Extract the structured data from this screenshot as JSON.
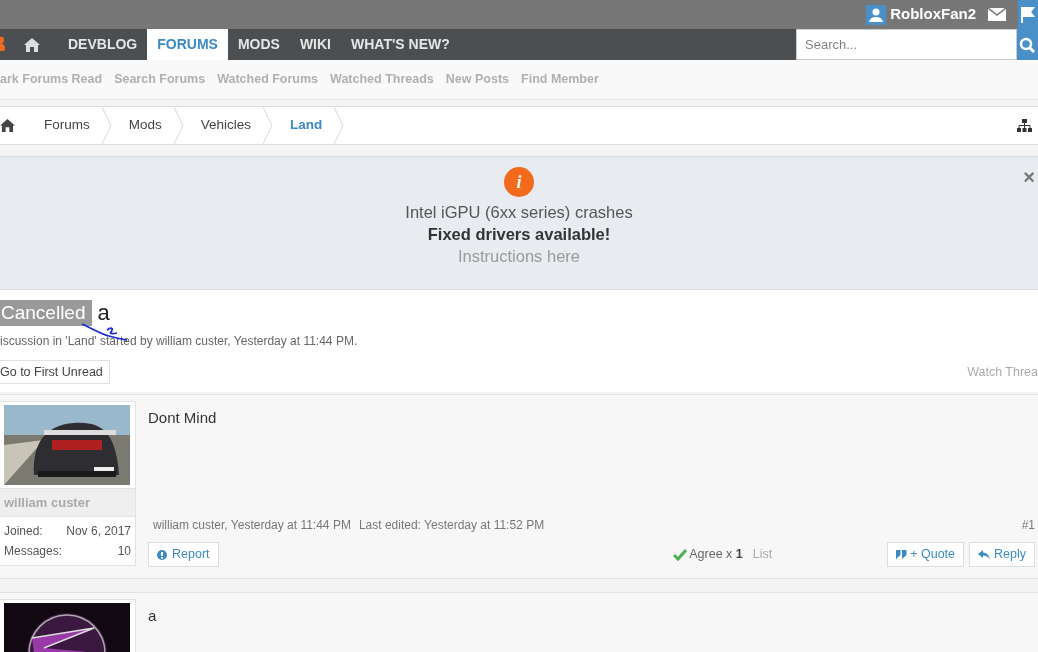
{
  "user_bar": {
    "username": "RobloxFan2"
  },
  "nav": {
    "tabs": [
      {
        "label": "DEVBLOG",
        "selected": false
      },
      {
        "label": "FORUMS",
        "selected": true
      },
      {
        "label": "MODS",
        "selected": false
      },
      {
        "label": "WIKI",
        "selected": false
      },
      {
        "label": "WHAT'S NEW?",
        "selected": false
      }
    ],
    "search": {
      "placeholder": "Search..."
    }
  },
  "sub_nav": [
    "ark Forums Read",
    "Search Forums",
    "Watched Forums",
    "Watched Threads",
    "New Posts",
    "Find Member"
  ],
  "breadcrumb": [
    {
      "label": "Forums",
      "selected": false
    },
    {
      "label": "Mods",
      "selected": false
    },
    {
      "label": "Vehicles",
      "selected": false
    },
    {
      "label": "Land",
      "selected": true
    }
  ],
  "notice": {
    "icon": "i",
    "lines": [
      "Intel iGPU (6xx series) crashes",
      "Fixed drivers available!",
      "Instructions here"
    ],
    "close": "×"
  },
  "thread": {
    "prefix": "Cancelled",
    "title": "a",
    "meta": "iscussion in 'Land' started by william custer, Yesterday at 11:44 PM.",
    "first_unread": "Go to First Unread",
    "watch": "Watch Threa"
  },
  "posts": [
    {
      "username": "william custer",
      "joined_label": "Joined:",
      "joined": "Nov 6, 2017",
      "messages_label": "Messages:",
      "messages": "10",
      "body": "Dont Mind",
      "byline": "william custer, Yesterday at 11:44 PM",
      "edited": "Last edited: Yesterday at 11:52 PM",
      "number": "#1",
      "report": "Report",
      "likes": {
        "label": "Agree x ",
        "count": "1",
        "list": "List"
      },
      "quote": "+ Quote",
      "reply": "Reply"
    },
    {
      "body": "a"
    }
  ]
}
